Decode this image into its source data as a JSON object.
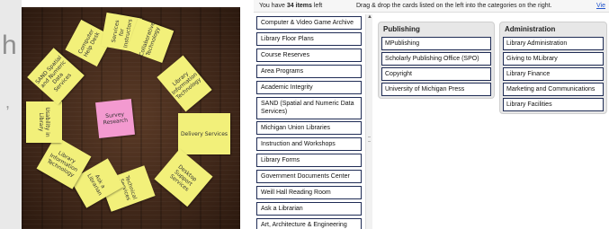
{
  "edge": {
    "letter": "h",
    "comma": ","
  },
  "photo": {
    "notes": [
      "Computer Help Desk",
      "Services for Instructors",
      "Collaborative Technology",
      "Library Information Technology",
      "Delivery Services",
      "Desktop Support Services",
      "Technical Services",
      "Ask a Librarian",
      "Library Information Technology",
      "Usability in Library",
      "SAND Spatial and Numeric Data Services",
      "Survey Research"
    ]
  },
  "status": {
    "prefix": "You have ",
    "count": "34 items",
    "suffix": " left",
    "instructions": "Drag & drop the cards listed on the left into the categories on the right.",
    "view_link": "Vie"
  },
  "cards": [
    "Computer & Video Game Archive",
    "Library Floor Plans",
    "Course Reserves",
    "Area Programs",
    "Academic Integrity",
    "SAND (Spatial and Numeric Data Services)",
    "Michigan Union Libraries",
    "Instruction and Workshops",
    "Library Forms",
    "Government Documents Center",
    "Weill Hall Reading Room",
    "Ask a Librarian",
    "Art, Architecture & Engineering Library"
  ],
  "categories": [
    {
      "title": "Publishing",
      "cards": [
        "MPublishing",
        "Scholarly Publishing Office (SPO)",
        "Copyright",
        "University of Michigan Press"
      ]
    },
    {
      "title": "Administration",
      "cards": [
        "Library Administration",
        "Giving to MLibrary",
        "Library Finance",
        "Marketing and Communications",
        "Library Facilities"
      ]
    }
  ]
}
